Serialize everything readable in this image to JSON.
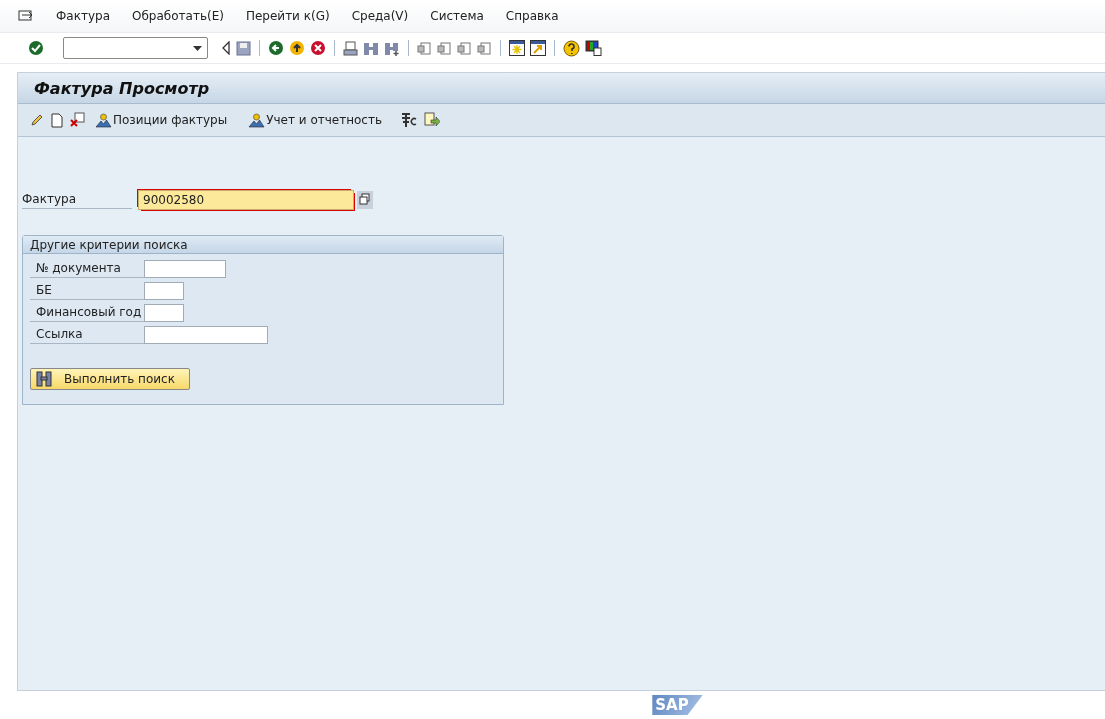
{
  "menu": [
    "Фактура",
    "Обработать(E)",
    "Перейти к(G)",
    "Среда(V)",
    "Система",
    "Справка"
  ],
  "title": "Фактура Просмотр",
  "app_toolbar": [
    {
      "kind": "people",
      "label": "Позиции фактуры"
    },
    {
      "kind": "people",
      "label": "Учет и отчетность"
    }
  ],
  "invoice": {
    "label": "Фактура",
    "value": "90002580",
    "required": true
  },
  "group": {
    "title": "Другие критерии поиска",
    "fields": [
      {
        "label": "№ документа"
      },
      {
        "label": "БЕ"
      },
      {
        "label": "Финансовый год"
      },
      {
        "label": "Ссылка"
      }
    ],
    "button": "Выполнить поиск"
  },
  "logo": "SAP"
}
